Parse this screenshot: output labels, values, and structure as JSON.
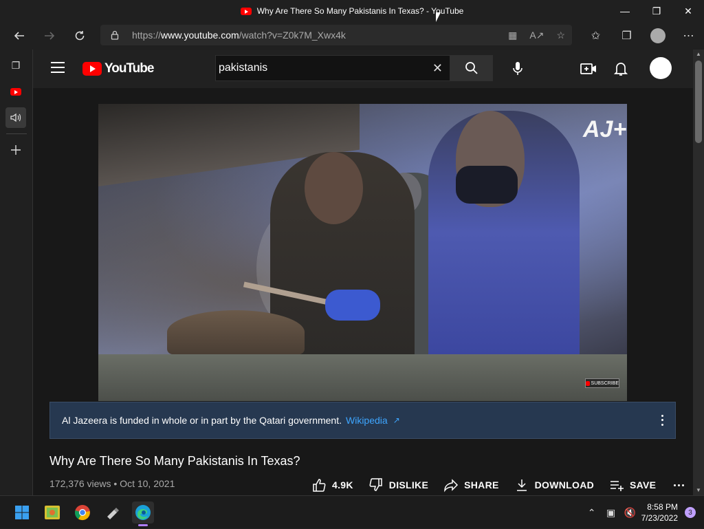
{
  "window": {
    "title": "Why Are There So Many Pakistanis In Texas? - YouTube"
  },
  "browser": {
    "url_prefix": "https://",
    "url_host": "www.youtube.com",
    "url_path": "/watch?v=Z0k7M_Xwx4k"
  },
  "youtube": {
    "logo_text": "YouTube",
    "search_value": "pakistanis",
    "video": {
      "watermark": "AJ+",
      "subscribe_label": "SUBSCRIBE"
    },
    "notice": {
      "text": "Al Jazeera is funded in whole or in part by the Qatari government.",
      "link": "Wikipedia"
    },
    "title": "Why Are There So Many Pakistanis In Texas?",
    "meta": "172,376 views • Oct 10, 2021",
    "actions": {
      "like_count": "4.9K",
      "dislike": "DISLIKE",
      "share": "SHARE",
      "download": "DOWNLOAD",
      "save": "SAVE"
    }
  },
  "taskbar": {
    "time": "8:58 PM",
    "date": "7/23/2022",
    "notification_count": "3"
  },
  "icons": {
    "back": "arrow-left-icon",
    "forward": "arrow-right-icon",
    "refresh": "refresh-icon",
    "lock": "lock-icon",
    "mic": "mic-icon",
    "bell": "bell-icon",
    "create": "video-plus-icon"
  },
  "colors": {
    "brand_red": "#ff0000",
    "link_blue": "#3ea6ff",
    "notice_bg": "#263850"
  }
}
